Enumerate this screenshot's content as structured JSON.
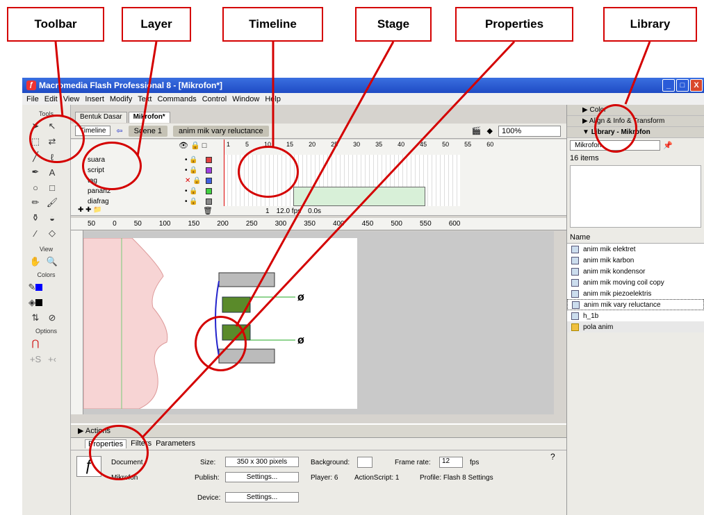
{
  "callouts": {
    "toolbar": "Toolbar",
    "layer": "Layer",
    "timeline": "Timeline",
    "stage": "Stage",
    "properties": "Properties",
    "library": "Library"
  },
  "window": {
    "title": "Macromedia Flash Professional 8 - [Mikrofon*]",
    "buttons": [
      "_",
      "□",
      "X"
    ]
  },
  "menu": [
    "File",
    "Edit",
    "View",
    "Insert",
    "Modify",
    "Text",
    "Commands",
    "Control",
    "Window",
    "Help"
  ],
  "tools": {
    "title": "Tools",
    "view_label": "View",
    "colors_label": "Colors",
    "options_label": "Options"
  },
  "doc": {
    "tabs": [
      "Bentuk Dasar",
      "Mikrofon*"
    ],
    "timeline_btn": "Timeline",
    "scene": "Scene 1",
    "symbol": "anim mik vary reluctance",
    "zoom": "100%"
  },
  "timeline": {
    "layers": [
      "suara",
      "script",
      "tag",
      "panah2",
      "diafrag"
    ],
    "frame_numbers": [
      "1",
      "5",
      "10",
      "15",
      "20",
      "25",
      "30",
      "35",
      "40",
      "45",
      "50",
      "55",
      "60"
    ],
    "status_frame": "1",
    "status_fps": "12.0 fps",
    "status_time": "0.0s"
  },
  "ruler": {
    "ticks": [
      "50",
      "0",
      "50",
      "100",
      "150",
      "200",
      "250",
      "300",
      "350",
      "400",
      "450",
      "500",
      "550",
      "600"
    ]
  },
  "actions": {
    "label": "Actions"
  },
  "properties": {
    "tabs": [
      "Properties",
      "Filters",
      "Parameters"
    ],
    "doc_label": "Document",
    "doc_name": "Mikrofon",
    "size_label": "Size:",
    "size_value": "350 x 300 pixels",
    "background_label": "Background:",
    "framerate_label": "Frame rate:",
    "framerate_value": "12",
    "fps_label": "fps",
    "publish_label": "Publish:",
    "settings_label": "Settings...",
    "player_label": "Player: 6",
    "actionscript_label": "ActionScript: 1",
    "profile_label": "Profile: Flash 8 Settings",
    "device_label": "Device:",
    "device_settings": "Settings..."
  },
  "right_panels": {
    "color": "Color",
    "align": "Align & Info & Transform",
    "library": "Library - Mikrofon",
    "library_select": "Mikrofon",
    "items_count": "16 items",
    "name_header": "Name"
  },
  "library_items": [
    "anim mik elektret",
    "anim mik karbon",
    "anim mik kondensor",
    "anim mik moving coil copy",
    "anim mik piezoelektris",
    "anim mik vary reluctance",
    "h_1b",
    "pola anim"
  ]
}
